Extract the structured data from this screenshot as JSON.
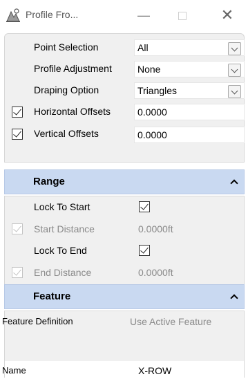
{
  "window": {
    "title": "Profile Fro...",
    "minimize": "—",
    "close": "✕",
    "app_icon": "profile-tool-icon"
  },
  "general": {
    "point_selection": {
      "label": "Point Selection",
      "value": "All"
    },
    "profile_adjustment": {
      "label": "Profile Adjustment",
      "value": "None"
    },
    "draping_option": {
      "label": "Draping Option",
      "value": "Triangles"
    },
    "horizontal_offsets": {
      "label": "Horizontal Offsets",
      "value": "0.0000",
      "checked": true
    },
    "vertical_offsets": {
      "label": "Vertical Offsets",
      "value": "0.0000",
      "checked": true
    }
  },
  "range": {
    "title": "Range",
    "lock_to_start": {
      "label": "Lock To Start",
      "checked": true
    },
    "start_distance": {
      "label": "Start Distance",
      "value": "0.0000ft",
      "checked": true,
      "enabled": false
    },
    "lock_to_end": {
      "label": "Lock To End",
      "checked": true
    },
    "end_distance": {
      "label": "End Distance",
      "value": "0.0000ft",
      "checked": true,
      "enabled": false
    }
  },
  "feature": {
    "title": "Feature",
    "feature_definition": {
      "label": "Feature Definition",
      "value": "Use Active Feature"
    },
    "name": {
      "label": "Name",
      "value": "X-ROW"
    }
  },
  "colors": {
    "section_header": "#c9d9f1",
    "panel_bg": "#f0f0f0",
    "disabled_text": "#8a8a8a"
  }
}
